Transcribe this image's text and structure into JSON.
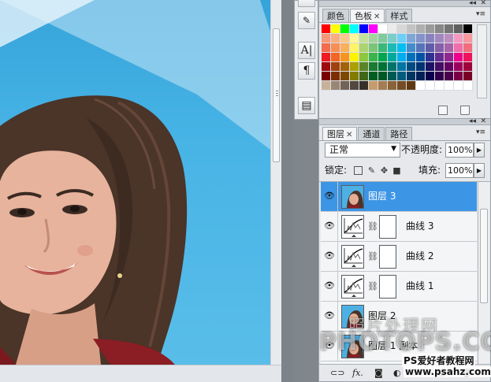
{
  "swatches_panel": {
    "tabs": [
      "颜色",
      "色板",
      "样式"
    ],
    "active_tab": 1,
    "colors": [
      "#ff0000",
      "#ffff00",
      "#00ff00",
      "#00ffff",
      "#0000ff",
      "#ff00ff",
      "#ffffff",
      "#ebebeb",
      "#d7d7d7",
      "#c3c3c3",
      "#afafaf",
      "#9b9b9b",
      "#878787",
      "#737373",
      "#5f5f5f",
      "#000000",
      "#f7977a",
      "#f9ad81",
      "#fdc68a",
      "#fff79a",
      "#c4df9b",
      "#a3d39c",
      "#82ca9d",
      "#7bcdc8",
      "#6ecff6",
      "#7ea7d8",
      "#8493ca",
      "#8882be",
      "#a187be",
      "#bc8dbf",
      "#f49ac2",
      "#f6989d",
      "#f26c4f",
      "#f68e55",
      "#fbaf5c",
      "#fff467",
      "#acd372",
      "#7cc576",
      "#3bb878",
      "#1abbb4",
      "#00bff3",
      "#438ccb",
      "#5574b9",
      "#605ca8",
      "#855fa8",
      "#a763a8",
      "#f06ea9",
      "#f26d7d",
      "#ed1c24",
      "#f26522",
      "#f7941d",
      "#fff200",
      "#8dc63f",
      "#39b54a",
      "#00a651",
      "#00a99d",
      "#00aeef",
      "#0072bc",
      "#0054a6",
      "#2e3192",
      "#662d91",
      "#92278f",
      "#ec008c",
      "#ed145b",
      "#9e0b0f",
      "#a0410d",
      "#a36209",
      "#aba000",
      "#598527",
      "#1a7b30",
      "#007236",
      "#00746b",
      "#0076a3",
      "#004b80",
      "#003471",
      "#1b1464",
      "#440e62",
      "#630460",
      "#9e005d",
      "#9e0039",
      "#790000",
      "#7b2e00",
      "#7d4900",
      "#827b00",
      "#406618",
      "#005e20",
      "#005826",
      "#005952",
      "#005b7f",
      "#003663",
      "#002157",
      "#0d004c",
      "#32004b",
      "#4b0049",
      "#7b0046",
      "#7a0026",
      "#c7b299",
      "#998675",
      "#736357",
      "#534741",
      "#37302a",
      "#c69c6d",
      "#a67c52",
      "#8c6239",
      "#754c24",
      "#603913",
      "#ffffff",
      "#ffffff",
      "#ffffff",
      "#ffffff",
      "#ffffff",
      "#ffffff"
    ]
  },
  "tool_column": {
    "buttons": [
      {
        "name": "character-icon",
        "glyph": "A|"
      },
      {
        "name": "paragraph-icon",
        "glyph": "¶"
      },
      {
        "name": "layer-comps-icon",
        "glyph": "▤"
      }
    ]
  },
  "layers_panel": {
    "tabs": [
      "图层",
      "通道",
      "路径"
    ],
    "active_tab": 0,
    "blend_mode": "正常",
    "opacity_label": "不透明度:",
    "opacity_value": "100%",
    "lock_label": "锁定:",
    "fill_label": "填充:",
    "fill_value": "100%",
    "layers": [
      {
        "name": "图层 3",
        "type": "image",
        "selected": true
      },
      {
        "name": "曲线 3",
        "type": "curves",
        "selected": false
      },
      {
        "name": "曲线 2",
        "type": "curves",
        "selected": false
      },
      {
        "name": "曲线 1",
        "type": "curves",
        "selected": false
      },
      {
        "name": "图层 2",
        "type": "image",
        "selected": false
      },
      {
        "name": "图层 1 副本",
        "type": "image",
        "selected": false
      }
    ],
    "footer_buttons": [
      "link-icon",
      "fx-icon",
      "mask-icon",
      "adjustment-icon",
      "folder-icon",
      "new-layer-icon",
      "trash-icon"
    ]
  },
  "watermark": {
    "line1": "照片处理网",
    "line2": "PHOTOPS.COM",
    "line3": "PS爱好者教程网",
    "line4": "www.psahz.com"
  }
}
